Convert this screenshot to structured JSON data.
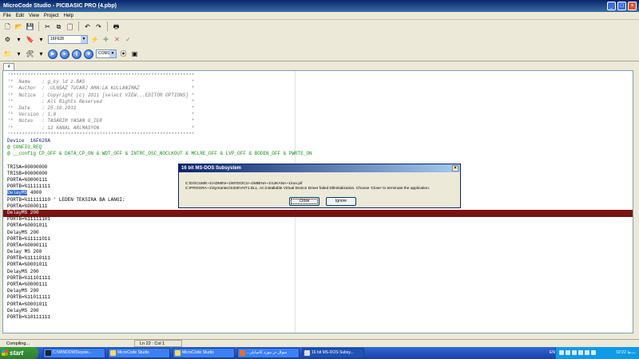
{
  "window": {
    "title": "MicroCode Studio - PICBASIC PRO (4.pbp)"
  },
  "menu": [
    "File",
    "Edit",
    "View",
    "Project",
    "Help"
  ],
  "toolbar": {
    "device": "16F628",
    "port": "COM1"
  },
  "tab": {
    "label": "4"
  },
  "code_lines": [
    {
      "t": "'****************************************************************",
      "c": "comment"
    },
    {
      "t": "'*  Name    : g_ky ld z.BAS                                     *",
      "c": "comment"
    },
    {
      "t": "'*  Author  : .ULNSAZ TUCARJ AMA:LA KULLANIMAZ                  *",
      "c": "comment"
    },
    {
      "t": "'*  Notice  : Copyright (c) 2011 [select VIEW...EDITOR OPTIONS] *",
      "c": "comment"
    },
    {
      "t": "'*          : All Rights Reserved                               *",
      "c": "comment"
    },
    {
      "t": "'*  Date    : 25.10.2011                                        *",
      "c": "comment"
    },
    {
      "t": "'*  Version : 1.0                                               *",
      "c": "comment"
    },
    {
      "t": "'*  Notes   : TASARIM YASAN G_IER                               *",
      "c": "comment"
    },
    {
      "t": "'*          : 12 KANAL ARLMASYON                                *",
      "c": "comment"
    },
    {
      "t": "'****************************************************************",
      "c": "comment"
    },
    {
      "t": "Device  16F628A",
      "c": "navy"
    },
    {
      "t": "@ CONFIG_REQ",
      "c": "green"
    },
    {
      "t": "@ __config CP_OFF & DATA_CP_ON & WDT_OFF & INTRC_OSC_NOCLKOUT & MCLRE_OFF & LVP_OFF & BODEN_OFF & PWRTE_ON",
      "c": "green"
    },
    {
      "t": "",
      "c": ""
    },
    {
      "t": "TRISA=00000000",
      "c": ""
    },
    {
      "t": "TRISB=00000000",
      "c": ""
    },
    {
      "t": "PORTA=%0000111",
      "c": ""
    },
    {
      "t": "PORTB=%11111111",
      "c": ""
    },
    {
      "t": "DelayMS 4000",
      "c": "sel"
    },
    {
      "t": "PORTB=%11111110 ' LEDEN TEKSIRA BA LANGI:",
      "c": ""
    },
    {
      "t": "PORTA=%0000111",
      "c": ""
    },
    {
      "t": "DelayMS 200",
      "c": "hl"
    },
    {
      "t": "PORTB=%11111101",
      "c": ""
    },
    {
      "t": "PORTA=%0001011",
      "c": ""
    },
    {
      "t": "DelayMS 200",
      "c": ""
    },
    {
      "t": "PORTB=%11111011",
      "c": ""
    },
    {
      "t": "PORTA=%0000111",
      "c": ""
    },
    {
      "t": "Delay MS 200",
      "c": ""
    },
    {
      "t": "PORTB=%11110111",
      "c": ""
    },
    {
      "t": "PORTA=%0001011",
      "c": ""
    },
    {
      "t": "DelayMS 200",
      "c": ""
    },
    {
      "t": "PORTB=%11101111",
      "c": ""
    },
    {
      "t": "PORTA=%0000111",
      "c": ""
    },
    {
      "t": "DelayMS 200",
      "c": ""
    },
    {
      "t": "PORTB=%11011111",
      "c": ""
    },
    {
      "t": "PORTA=%0001011",
      "c": ""
    },
    {
      "t": "DelayMS 200",
      "c": ""
    },
    {
      "t": "PORTB=%10111111",
      "c": ""
    }
  ],
  "dialog": {
    "title": "16 bit MS-DOS Subsystem",
    "line1": "C:\\DOCUME~1\\ADMINI~1\\MYDOCU~1\\MBINA~1\\14KANA~1\\run.pif",
    "line2": "C:\\PROGRA~1\\Symantec\\S32EVNT1.DLL. An installable Virtual Device Driver failed DllInitialization. Choose 'Close' to terminate the application.",
    "close_label": "Close",
    "ignore_label": "Ignore"
  },
  "status": {
    "left": "Compiling...",
    "position": "Ln 22 : Col 1"
  },
  "taskbar": {
    "start": "start",
    "tasks": [
      "C:\\WINDOWS\\syste...",
      "MicroCode Studio",
      "MicroCode Studio",
      "...سوال در مورد کامپایلر",
      "16 bit MS-DOS Subsy..."
    ],
    "lang": "EN",
    "clock": "02:22 ب.ظ"
  }
}
